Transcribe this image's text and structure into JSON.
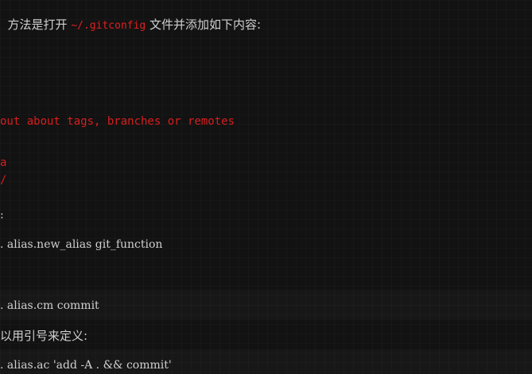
{
  "colors": {
    "background": "#121212",
    "text": "#d0d0d0",
    "accent_red": "#d81e1e"
  },
  "intro": {
    "before": "方法是打开 ",
    "code": "~/.gitconfig",
    "after": " 文件并添加如下内容:"
  },
  "code_lines": {
    "comment_tags": "out about tags, branches or remotes",
    "fragment_a": "a",
    "fragment_slash": "/"
  },
  "fragment_colon": ":",
  "command_new_alias": ". alias.new_alias git_function",
  "command_cm": ". alias.cm commit",
  "note_quotes": "以用引号来定义:",
  "command_ac": ". alias.ac 'add -A . && commit'"
}
